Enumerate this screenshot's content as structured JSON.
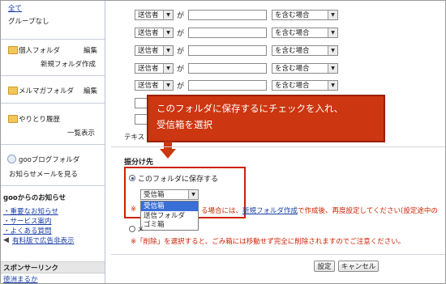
{
  "sidebar": {
    "all": "全て",
    "no_group": "グループなし",
    "personal_folder": "個人フォルダ",
    "edit1": "編集",
    "new_folder": "新規フォルダ作成",
    "mailmag_folder": "メルマガフォルダ",
    "edit2": "編集",
    "history": "やりとり履歴",
    "list_view": "一覧表示",
    "goo_blog": "gooブログフォルダ",
    "notify_mail": "お知らせメールを見る",
    "goo_news_title": "gooからのお知らせ",
    "news_items": [
      "・重要なお知らせ",
      "・サービス案内",
      "・よくある質問"
    ],
    "paid_ad": "有料版で広告非表示",
    "sponsor_title": "スポンサーリンク",
    "sponsor_item": "徳洲まるか"
  },
  "filters": {
    "rows": [
      {
        "field": "送信者",
        "ga": "が",
        "value": "",
        "cond": "を含む場合"
      },
      {
        "field": "送信者",
        "ga": "が",
        "value": "",
        "cond": "を含む場合"
      },
      {
        "field": "送信者",
        "ga": "が",
        "value": "",
        "cond": "を含む場合"
      },
      {
        "field": "送信者",
        "ga": "が",
        "value": "",
        "cond": "を含む場合"
      },
      {
        "field": "送信者",
        "ga": "が",
        "value": "",
        "cond": "を含む場合"
      }
    ],
    "text_label": "テキス"
  },
  "callout": {
    "line1": "このフォルダに保存するにチェックを入れ、",
    "line2": "受信箱を選択"
  },
  "sort": {
    "title": "振分け先",
    "save_option": "このフォルダに保存する",
    "folder_selected": "受信箱",
    "dropdown_options": [
      "受信箱",
      "送信フォルダ",
      "ゴミ箱"
    ],
    "note1_prefix": "※",
    "note1_mid": "る場合には、",
    "note1_link": "新規フォルダ作成",
    "note1_suffix": "で作成後、再度設定してください(設定途中の",
    "delete_option_prefix": "メ",
    "note2": "※「削除」を選択すると、ごみ箱には移動せず完全に削除されますのでご注意ください。"
  },
  "buttons": {
    "save": "設定",
    "cancel": "キャンセル"
  },
  "colors": {
    "callout_bg": "#cc3610",
    "note_red": "#cc2200",
    "link_blue": "#1a3ea8",
    "highlight_blue": "#3a6fd8"
  }
}
